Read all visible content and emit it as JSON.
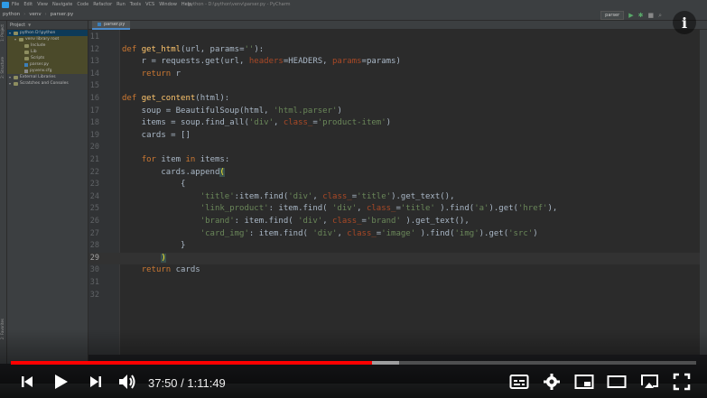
{
  "ide": {
    "menu_items": [
      "File",
      "Edit",
      "View",
      "Navigate",
      "Code",
      "Refactor",
      "Run",
      "Tools",
      "VCS",
      "Window",
      "Help"
    ],
    "window_title": "python - D:\\python\\venv\\parser.py - PyCharm",
    "breadcrumbs": [
      "python",
      "venv",
      "parser.py"
    ],
    "run_config": "parser",
    "project_panel_title": "Project",
    "tree": [
      {
        "label": "python  D:\\python",
        "type": "folder",
        "depth": 0,
        "state": "sel"
      },
      {
        "label": "venv  library root",
        "type": "folder",
        "depth": 1,
        "state": "hl"
      },
      {
        "label": "Include",
        "type": "folder",
        "depth": 2,
        "state": "hl"
      },
      {
        "label": "Lib",
        "type": "folder",
        "depth": 2,
        "state": "hl"
      },
      {
        "label": "Scripts",
        "type": "folder",
        "depth": 2,
        "state": "hl"
      },
      {
        "label": "parser.py",
        "type": "py",
        "depth": 2,
        "state": "hl"
      },
      {
        "label": "pyvenv.cfg",
        "type": "file",
        "depth": 2,
        "state": "hl"
      },
      {
        "label": "External Libraries",
        "type": "folder",
        "depth": 0,
        "state": ""
      },
      {
        "label": "Scratches and Consoles",
        "type": "folder",
        "depth": 0,
        "state": ""
      }
    ],
    "side_labels": [
      "1: Project",
      "2: Structure",
      "2: Favorites"
    ],
    "active_tab": "parser.py",
    "current_line": 29
  },
  "code_lines": [
    {
      "n": 11,
      "html": ""
    },
    {
      "n": 12,
      "html": "<span class=\"kw\">def</span> <span class=\"fn\">get_html</span>(url, params=<span class=\"str\">''</span>):"
    },
    {
      "n": 13,
      "html": "    r = requests.get(url, <span class=\"prm\">headers</span>=HEADERS, <span class=\"prm\">params</span>=params)"
    },
    {
      "n": 14,
      "html": "    <span class=\"kw\">return</span> r"
    },
    {
      "n": 15,
      "html": ""
    },
    {
      "n": 16,
      "html": "<span class=\"kw\">def</span> <span class=\"fn\">get_content</span>(html):"
    },
    {
      "n": 17,
      "html": "    soup = BeautifulSoup(html, <span class=\"str\">'html.parser'</span>)"
    },
    {
      "n": 18,
      "html": "    items = soup.find_all(<span class=\"str\">'div'</span>, <span class=\"prm\">class_</span>=<span class=\"str\">'product-item'</span>)"
    },
    {
      "n": 19,
      "html": "    cards = []"
    },
    {
      "n": 20,
      "html": ""
    },
    {
      "n": 21,
      "html": "    <span class=\"kw\">for</span> item <span class=\"kw\">in</span> items:"
    },
    {
      "n": 22,
      "html": "        cards.append<span class=\"brk\">(</span>"
    },
    {
      "n": 23,
      "html": "            {"
    },
    {
      "n": 24,
      "html": "                <span class=\"str\">'title'</span>:item.find(<span class=\"str\">'div'</span>, <span class=\"prm\">class_</span>=<span class=\"str\">'title'</span>).get_text(),"
    },
    {
      "n": 25,
      "html": "                <span class=\"str\">'link_product'</span>: item.find( <span class=\"str\">'div'</span>, <span class=\"prm\">class_</span>=<span class=\"str\">'title'</span> ).find(<span class=\"str\">'a'</span>).get(<span class=\"str\">'href'</span>),"
    },
    {
      "n": 26,
      "html": "                <span class=\"str\">'brand'</span>: item.find( <span class=\"str\">'div'</span>, <span class=\"prm\">class_</span>=<span class=\"str\">'brand'</span> ).get_text(),"
    },
    {
      "n": 27,
      "html": "                <span class=\"str\">'card_img'</span>: item.find( <span class=\"str\">'div'</span>, <span class=\"prm\">class_</span>=<span class=\"str\">'image'</span> ).find(<span class=\"str\">'img'</span>).get(<span class=\"str\">'src'</span>)"
    },
    {
      "n": 28,
      "html": "            }"
    },
    {
      "n": 29,
      "html": "        <span class=\"brk\">)</span>"
    },
    {
      "n": 30,
      "html": "    <span class=\"kw\">return</span> cards"
    },
    {
      "n": 31,
      "html": ""
    },
    {
      "n": 32,
      "html": ""
    }
  ],
  "player": {
    "current_time": "37:50",
    "duration": "1:11:49",
    "time_display": "37:50 / 1:11:49",
    "played_fraction": 0.527,
    "buffered_fraction": 0.566,
    "accent_color": "#ff0000",
    "icons": [
      "previous-icon",
      "play-icon",
      "next-icon",
      "volume-icon",
      "subtitles-icon",
      "settings-icon",
      "miniplayer-icon",
      "theater-icon",
      "cast-icon",
      "fullscreen-icon"
    ]
  }
}
